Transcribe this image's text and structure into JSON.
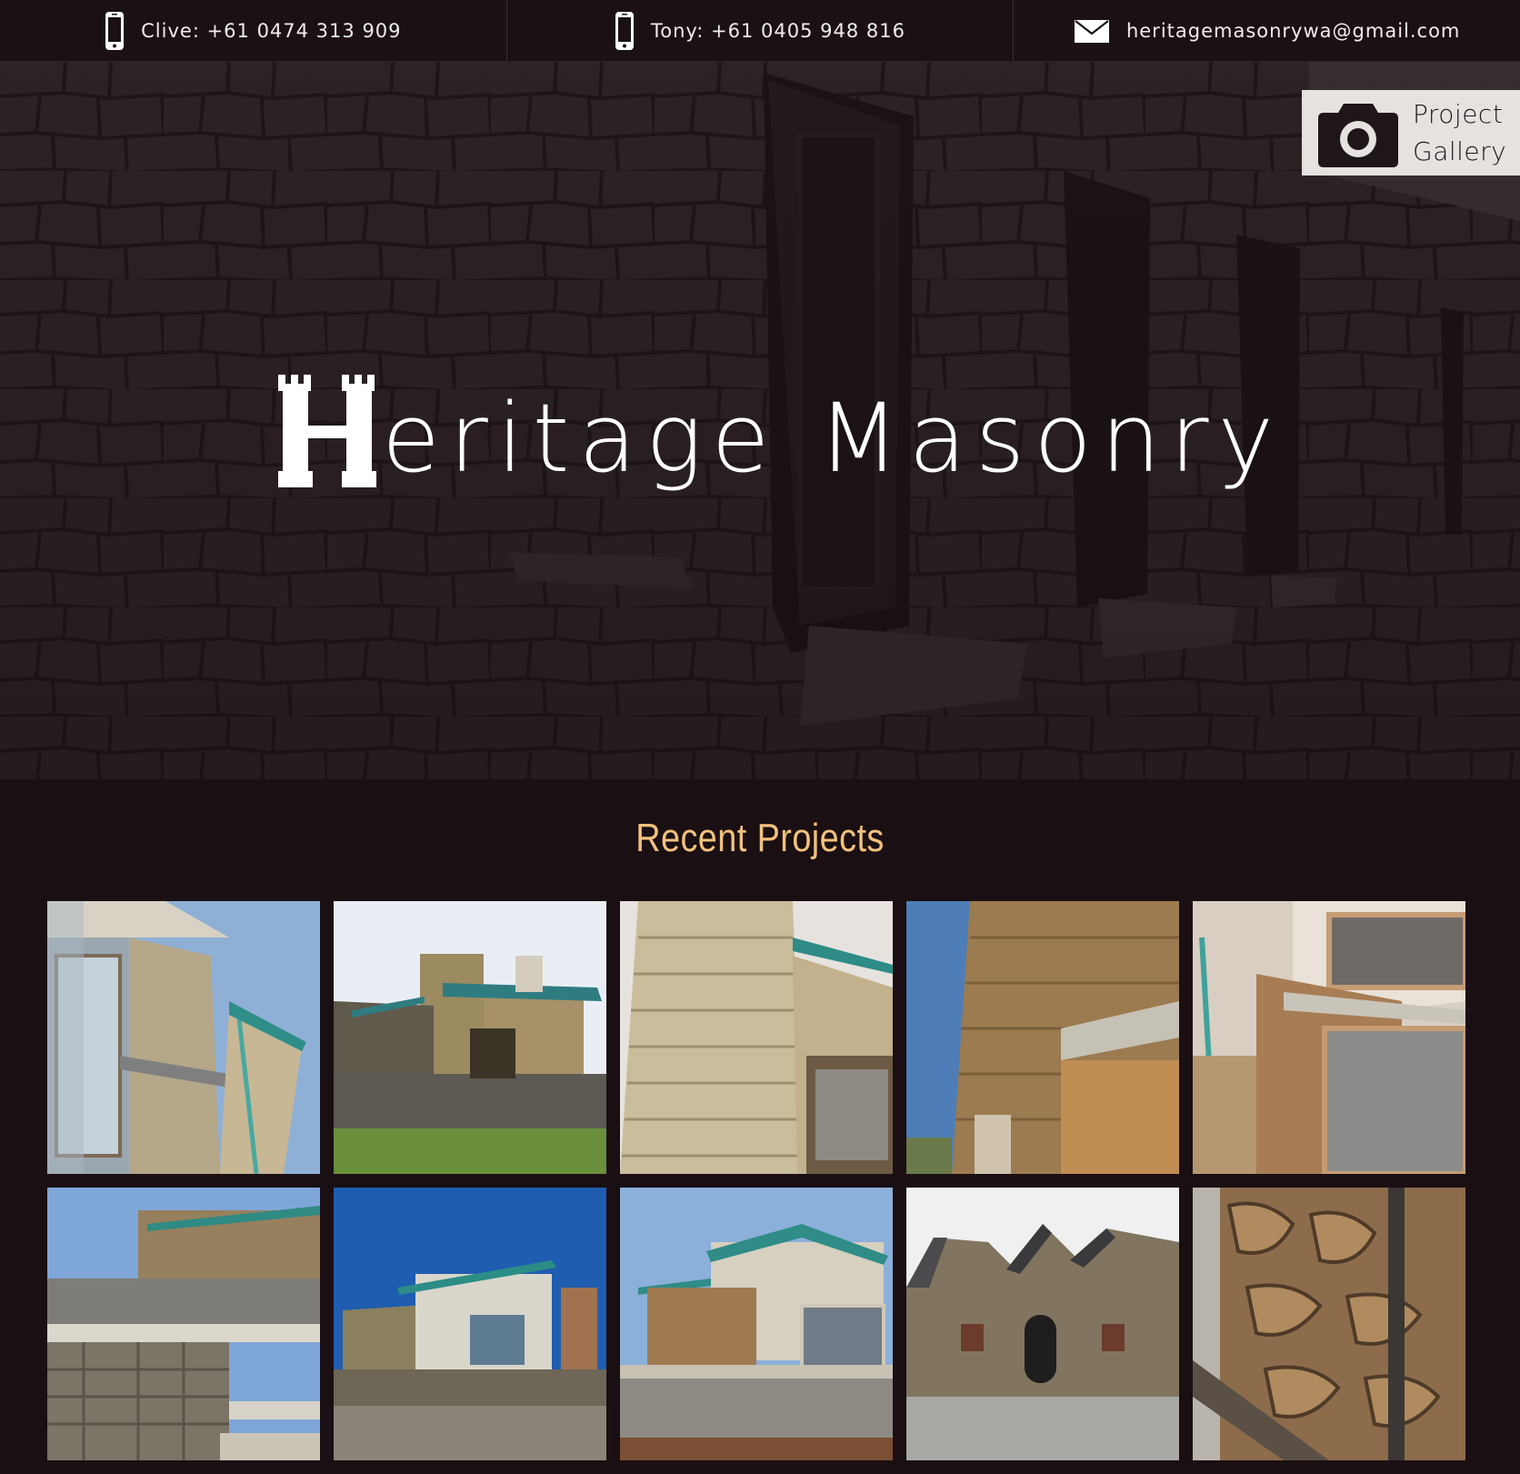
{
  "contacts": [
    {
      "type": "phone",
      "icon": "mobile-phone-icon",
      "text": "Clive: +61 0474 313 909"
    },
    {
      "type": "phone",
      "icon": "mobile-phone-icon",
      "text": "Tony: +61 0405 948 816"
    },
    {
      "type": "email",
      "icon": "envelope-icon",
      "text": "heritagemasonrywa@gmail.com"
    }
  ],
  "gallery_button": {
    "icon": "camera-icon",
    "line1": "Project",
    "line2": "Gallery"
  },
  "hero": {
    "title_initial": "H",
    "title_rest": "eritage Masonry"
  },
  "projects": {
    "heading": "Recent Projects",
    "heading_color": "#f2c27c",
    "thumbnails": [
      "project-thumb-1",
      "project-thumb-2",
      "project-thumb-3",
      "project-thumb-4",
      "project-thumb-5",
      "project-thumb-6",
      "project-thumb-7",
      "project-thumb-8",
      "project-thumb-9",
      "project-thumb-10"
    ]
  },
  "colors": {
    "bar_bg": "#1b1115",
    "page_bg": "#1a0f12",
    "accent": "#f2c27c",
    "button_bg": "#e6e2e0"
  }
}
